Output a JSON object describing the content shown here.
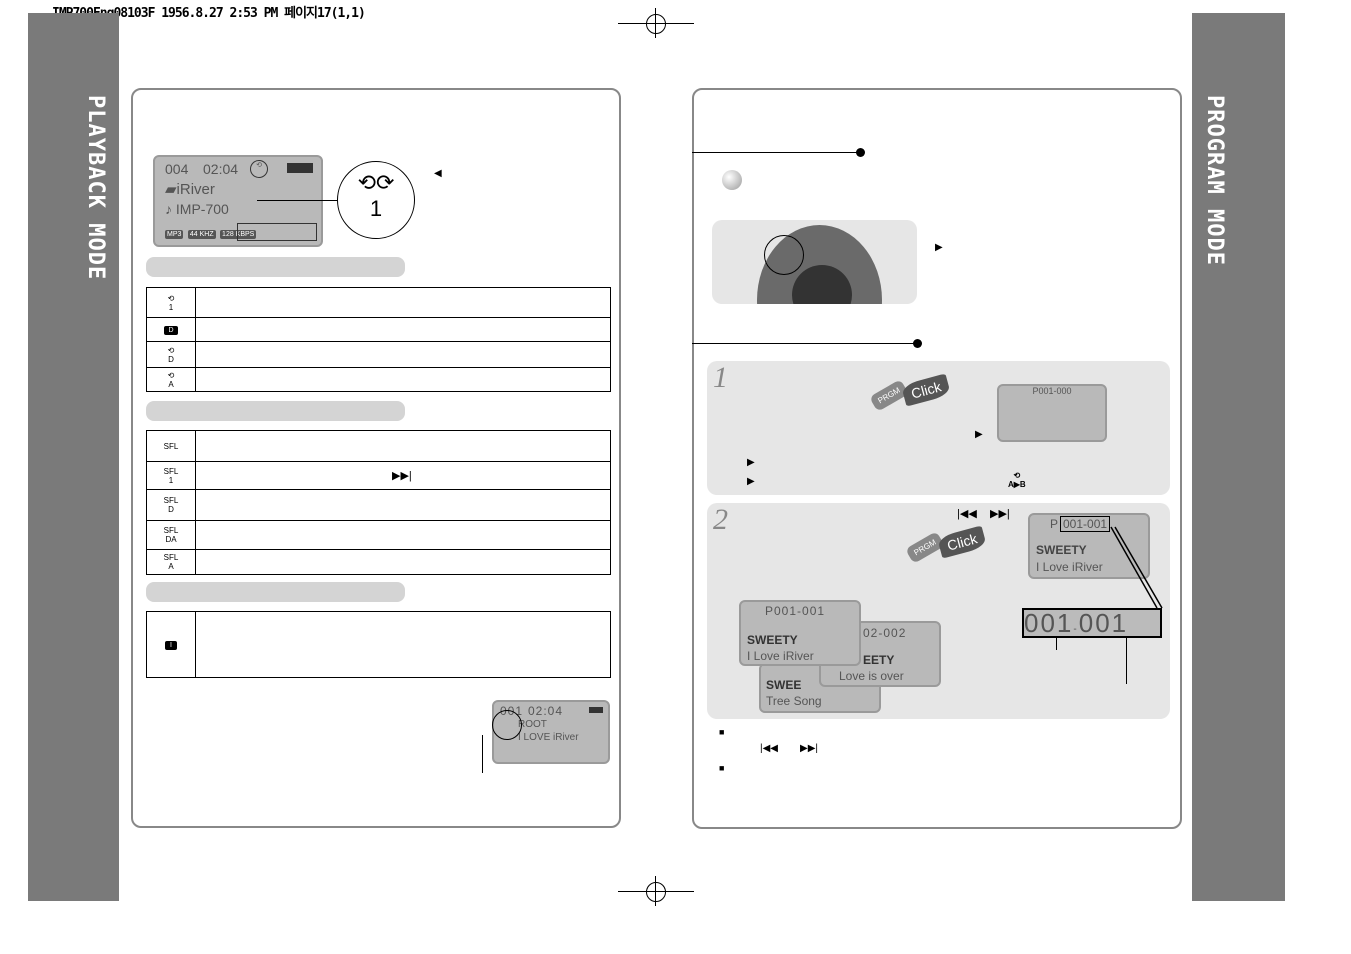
{
  "header": {
    "print_info": "IMP700Eng08103F 1956.8.27 2:53 PM 페이지17(1,1)"
  },
  "left": {
    "side_title": "PLAYBACK MODE",
    "lcd": {
      "track": "004",
      "time": "02:04",
      "folder": "iRiver",
      "file": "IMP-700",
      "fmt": "MP3",
      "khz": "44 KHZ",
      "kbps": "128 KBPS",
      "repeat_label": "1"
    },
    "repeat_rows": [
      {
        "icon": "repeat-1-icon",
        "label": "1"
      },
      {
        "icon": "dir-icon",
        "label": "D"
      },
      {
        "icon": "repeat-dir-icon",
        "label": "D"
      },
      {
        "icon": "repeat-all-icon",
        "label": "A"
      }
    ],
    "shuffle_rows": [
      {
        "label": "SFL",
        "sub": ""
      },
      {
        "label": "SFL",
        "sub": "1"
      },
      {
        "label": "SFL",
        "sub": "D"
      },
      {
        "label": "SFL",
        "sub": "DA"
      },
      {
        "label": "SFL",
        "sub": "A"
      }
    ],
    "intro_row": {
      "icon": "intro-icon",
      "label": "I"
    },
    "lcd2": {
      "track": "001",
      "time": "02:04",
      "folder": "ROOT",
      "file": "I LOVE iRiver"
    }
  },
  "right": {
    "side_title": "PROGRAM MODE",
    "step1": {
      "number": "1",
      "prgm": "PRGM",
      "click": "Click",
      "lcd": "P001-000",
      "ab": "A▶B"
    },
    "step2": {
      "number": "2",
      "prgm": "PRGM",
      "click": "Click",
      "lcd": {
        "code_prefix": "P",
        "code": "001-001",
        "folder": "SWEETY",
        "file": "I Love iRiver"
      },
      "big_readout": {
        "left": "001",
        "sep": "-",
        "right": "001"
      },
      "stack": [
        {
          "code": "P001-001",
          "folder": "SWEETY",
          "file": "I Love iRiver"
        },
        {
          "code": "02-002",
          "folder": "EETY",
          "file": "Love is over"
        },
        {
          "folder": "SWEE",
          "file": "Tree Song"
        }
      ]
    }
  }
}
